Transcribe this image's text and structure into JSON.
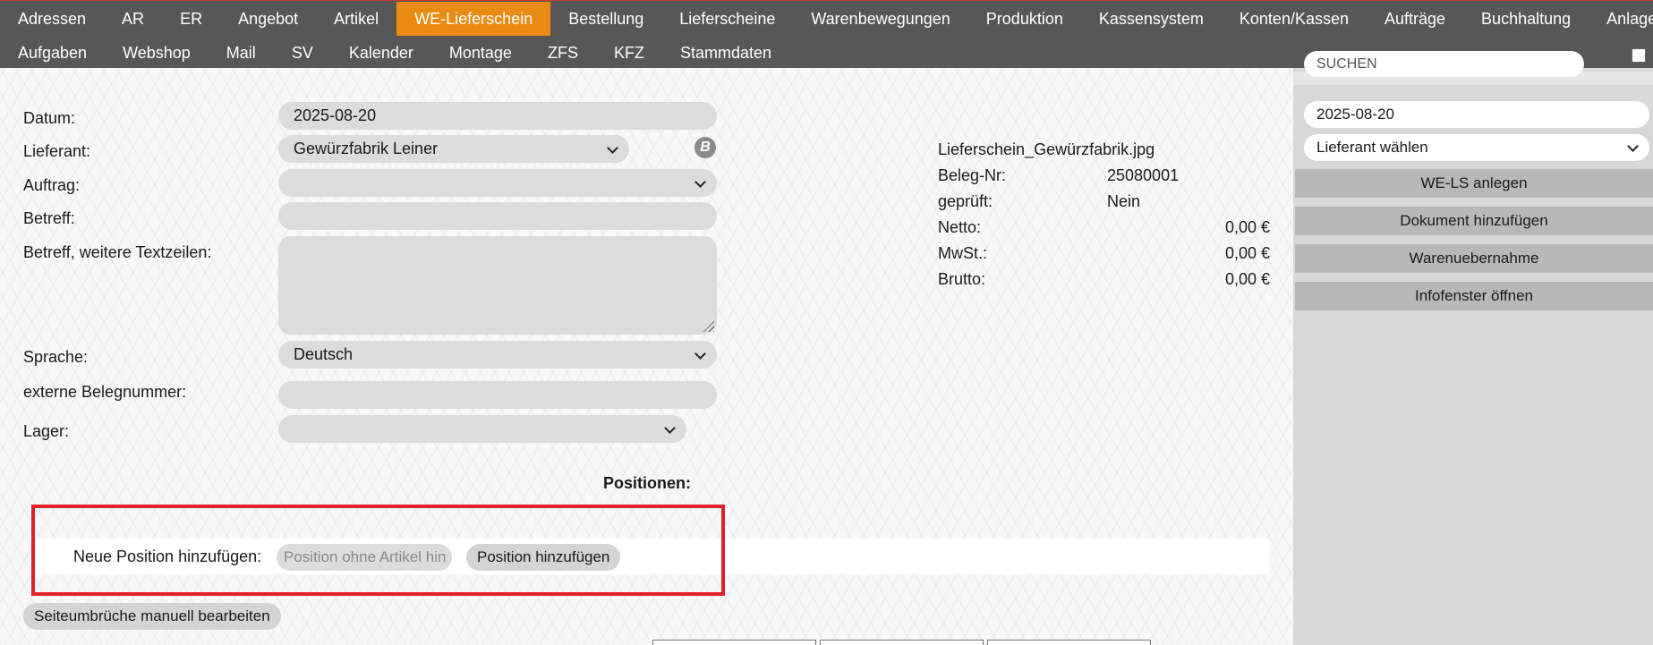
{
  "nav": {
    "row1": [
      "Adressen",
      "AR",
      "ER",
      "Angebot",
      "Artikel",
      "WE-Lieferschein",
      "Bestellung",
      "Lieferscheine",
      "Warenbewegungen",
      "Produktion",
      "Kassensystem",
      "Konten/Kassen",
      "Aufträge",
      "Buchhaltung",
      "Anlagen"
    ],
    "row2": [
      "Aufgaben",
      "Webshop",
      "Mail",
      "SV",
      "Kalender",
      "Montage",
      "ZFS",
      "KFZ",
      "Stammdaten"
    ],
    "active": "WE-Lieferschein"
  },
  "form": {
    "datum_label": "Datum:",
    "datum_value": "2025-08-20",
    "lieferant_label": "Lieferant:",
    "lieferant_value": "Gewürzfabrik Leiner",
    "lieferant_icon_letter": "B",
    "auftrag_label": "Auftrag:",
    "auftrag_value": "",
    "betreff_label": "Betreff:",
    "betreff_value": "",
    "betreff_weitere_label": "Betreff, weitere Textzeilen:",
    "betreff_weitere_value": "",
    "sprache_label": "Sprache:",
    "sprache_value": "Deutsch",
    "externe_label": "externe Belegnummer:",
    "externe_value": "",
    "lager_label": "Lager:",
    "lager_value": ""
  },
  "info": {
    "filename": "Lieferschein_Gewürzfabrik.jpg",
    "beleg_label": "Beleg-Nr:",
    "beleg_value": "25080001",
    "geprueft_label": "geprüft:",
    "geprueft_value": "Nein",
    "netto_label": "Netto:",
    "netto_value": "0,00 €",
    "mwst_label": "MwSt.:",
    "mwst_value": "0,00 €",
    "brutto_label": "Brutto:",
    "brutto_value": "0,00 €"
  },
  "positions": {
    "heading": "Positionen:",
    "new_label": "Neue Position hinzufügen:",
    "input_placeholder": "Position ohne Artikel hin",
    "add_button": "Position hinzufügen",
    "page_breaks_button": "Seiteumbrüche manuell bearbeiten"
  },
  "sidebar": {
    "search_placeholder": "SUCHEN",
    "date_value": "2025-08-20",
    "lieferant_select": "Lieferant wählen",
    "buttons": [
      "WE-LS anlegen",
      "Dokument hinzufügen",
      "Warenuebernahme",
      "Infofenster öffnen"
    ]
  },
  "colors": {
    "nav_bg": "#575757",
    "nav_active": "#e98b12",
    "highlight_border": "#e0202a"
  }
}
